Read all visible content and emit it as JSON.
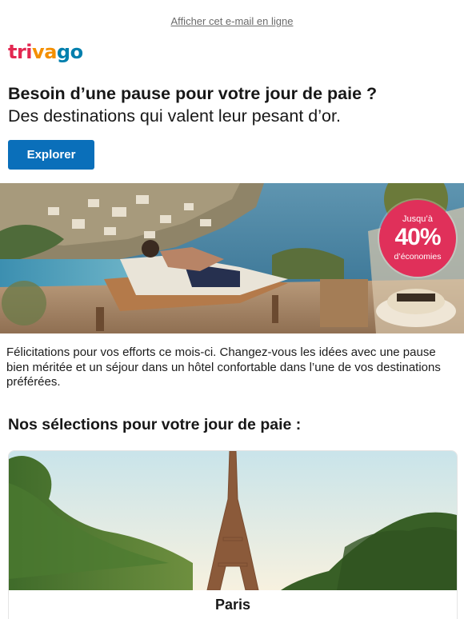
{
  "header": {
    "view_online": "Afficher cet e-mail en ligne",
    "logo": {
      "part1": "tri",
      "part2": "va",
      "part3": "go"
    }
  },
  "intro": {
    "headline": "Besoin d’une pause pour votre jour de paie ?",
    "subheadline": "Des destinations qui valent leur pesant d’or.",
    "cta_label": "Explorer"
  },
  "badge": {
    "line1": "Jusqu’à",
    "line2": "40%",
    "line3": "d’économies"
  },
  "body_text": "Félicitations pour vos efforts ce mois-ci. Changez-vous les idées avec une pause bien méritée et un séjour dans un hôtel confortable dans l’une de vos destinations préférées.",
  "section": {
    "title": "Nos sélections pour votre jour de paie :"
  },
  "destinations": [
    {
      "name": "Paris"
    }
  ],
  "colors": {
    "brand_red": "#e32851",
    "brand_orange": "#f48f00",
    "brand_blue": "#007fad",
    "cta_blue": "#0a6fba",
    "badge_pink": "#e0305a"
  }
}
